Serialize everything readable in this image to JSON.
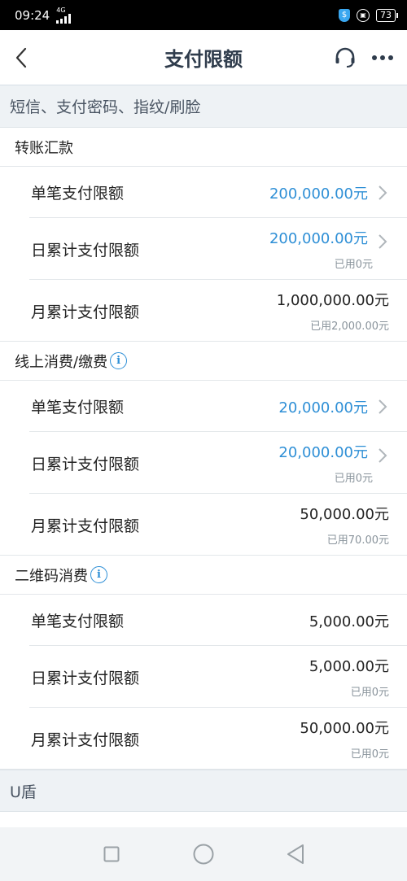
{
  "status_bar": {
    "time": "09:24",
    "network": "4G",
    "battery": "73"
  },
  "header": {
    "title": "支付限额"
  },
  "subheader": "短信、支付密码、指纹/刷脸",
  "sections": [
    {
      "title": "转账汇款",
      "rows": [
        {
          "label": "单笔支付限额",
          "amount": "200,000.00元",
          "used": ""
        },
        {
          "label": "日累计支付限额",
          "amount": "200,000.00元",
          "used": "已用0元"
        },
        {
          "label": "月累计支付限额",
          "amount": "1,000,000.00元",
          "used": "已用2,000.00元"
        }
      ]
    },
    {
      "title": "线上消费/缴费",
      "info_icon": "i",
      "rows": [
        {
          "label": "单笔支付限额",
          "amount": "20,000.00元",
          "used": ""
        },
        {
          "label": "日累计支付限额",
          "amount": "20,000.00元",
          "used": "已用0元"
        },
        {
          "label": "月累计支付限额",
          "amount": "50,000.00元",
          "used": "已用70.00元"
        }
      ]
    },
    {
      "title": "二维码消费",
      "info_icon": "i",
      "rows": [
        {
          "label": "单笔支付限额",
          "amount": "5,000.00元",
          "used": ""
        },
        {
          "label": "日累计支付限额",
          "amount": "5,000.00元",
          "used": "已用0元"
        },
        {
          "label": "月累计支付限额",
          "amount": "50,000.00元",
          "used": "已用0元"
        }
      ]
    }
  ],
  "footer_section": "U盾",
  "colors": {
    "accent": "#2e8fd6",
    "title": "#2f3c4c",
    "strip_bg": "#eef2f5"
  }
}
